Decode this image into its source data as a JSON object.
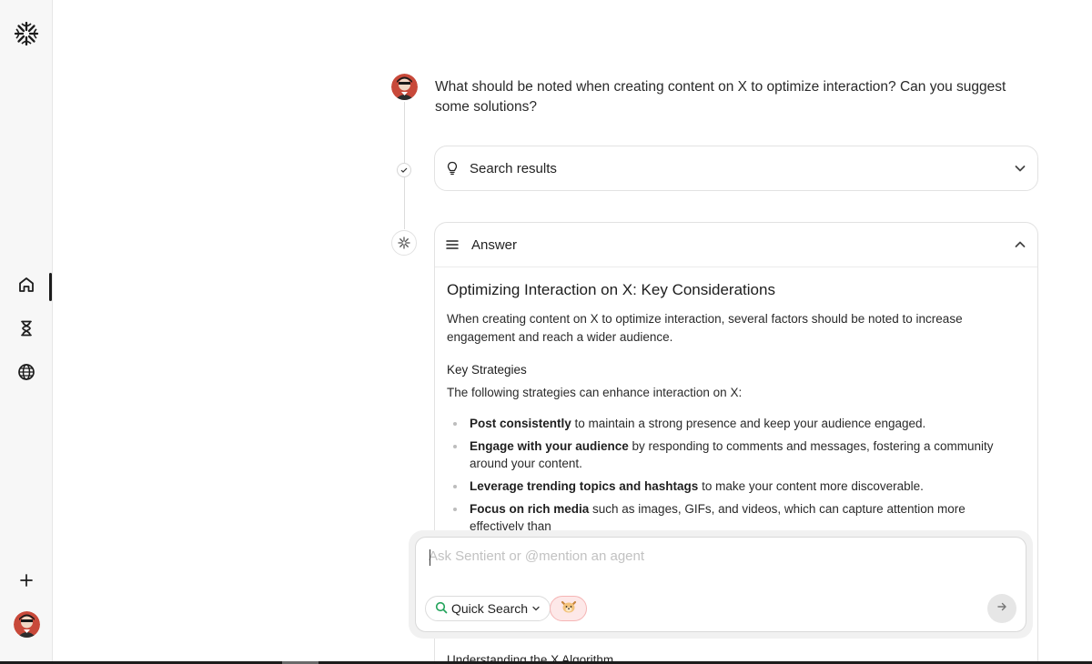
{
  "sidebar": {
    "logo_icon": "sentient-logo-icon",
    "items": [
      {
        "name": "home",
        "icon": "home-icon",
        "active": true
      },
      {
        "name": "history",
        "icon": "hourglass-icon",
        "active": false
      },
      {
        "name": "explore",
        "icon": "globe-icon",
        "active": false
      }
    ],
    "new_icon": "plus-icon",
    "avatar_icon": "user-avatar"
  },
  "conversation": {
    "question": "What should be noted when creating content on X to optimize interaction? Can you suggest some solutions?",
    "search_results": {
      "label": "Search results",
      "icon": "lightbulb-icon",
      "collapsed": true
    },
    "answer": {
      "label": "Answer",
      "icon": "menu-lines-icon",
      "expanded": true,
      "title": "Optimizing Interaction on X: Key Considerations",
      "intro": "When creating content on X to optimize interaction, several factors should be noted to increase engagement and reach a wider audience.",
      "subheading": "Key Strategies",
      "lead": "The following strategies can enhance interaction on X:",
      "items": [
        {
          "bold": "Post consistently",
          "rest": " to maintain a strong presence and keep your audience engaged."
        },
        {
          "bold": "Engage with your audience",
          "rest": " by responding to comments and messages, fostering a community around your content."
        },
        {
          "bold": "Leverage trending topics and hashtags",
          "rest": " to make your content more discoverable."
        },
        {
          "bold": "Focus on rich media",
          "rest": " such as images, GIFs, and videos, which can capture attention more effectively than"
        }
      ],
      "next_heading": "Understanding the X Algorithm"
    }
  },
  "composer": {
    "placeholder": "Ask Sentient or @mention an agent",
    "value": "",
    "mode_label": "Quick Search",
    "agent_chip_icon": "dog-face-icon"
  },
  "colors": {
    "sidebar_bg": "#f7f7f7",
    "accent_dark": "#1c1c1c",
    "border": "#e2e2e2",
    "agent_chip_bg": "#fde8e8",
    "search_green": "#22a35a"
  }
}
